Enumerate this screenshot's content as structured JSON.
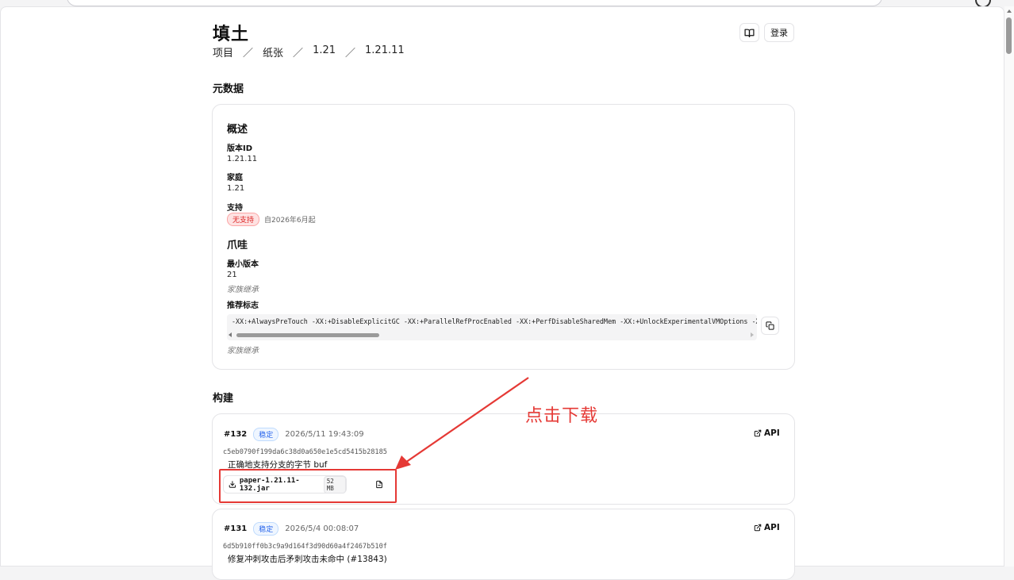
{
  "page": {
    "title": "填土",
    "breadcrumbs": [
      "项目",
      "纸张",
      "1.21",
      "1.21.11"
    ],
    "login_label": "登录"
  },
  "metadata": {
    "section_title": "元数据",
    "overview": {
      "heading": "概述",
      "version_label": "版本ID",
      "version_value": "1.21.11",
      "family_label": "家庭",
      "family_value": "1.21",
      "support_label": "支持",
      "support_badge": "无支持",
      "support_note": "自2026年6月起"
    },
    "java": {
      "heading": "爪哇",
      "min_version_label": "最小版本",
      "min_version_value": "21",
      "min_version_note": "家族继承",
      "flags_label": "推荐标志",
      "flags_value": "-XX:+AlwaysPreTouch -XX:+DisableExplicitGC -XX:+ParallelRefProcEnabled -XX:+PerfDisableSharedMem -XX:+UnlockExperimentalVMOptions -XX",
      "flags_note": "家族继承"
    }
  },
  "builds": {
    "section_title": "构建",
    "api_label": "API",
    "items": [
      {
        "number": "#132",
        "channel": "稳定",
        "date": "2026/5/11 19:43:09",
        "hash": "c5eb0790f199da6c38d0a650e1e5cd5415b28185",
        "message": "正确地支持分支的字节 buf",
        "download_name": "paper-1.21.11-132.jar",
        "download_size": "52 MB"
      },
      {
        "number": "#131",
        "channel": "稳定",
        "date": "2026/5/4 00:08:07",
        "hash": "6d5b910ff0b3c9a9d164f3d90d60a4f2467b510f",
        "message": "修复冲刺攻击后矛刺攻击未命中 (#13843)"
      }
    ]
  },
  "annotation": {
    "text": "点击下载",
    "color": "#e53935"
  }
}
